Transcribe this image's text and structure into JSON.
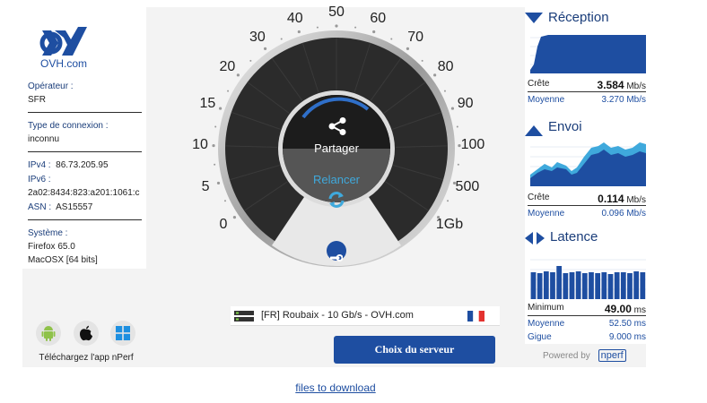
{
  "brand": {
    "name": "OVH.com"
  },
  "info": {
    "operator_label": "Opérateur :",
    "operator_value": "SFR",
    "connection_label": "Type de connexion :",
    "connection_value": "inconnu",
    "ipv4_label": "IPv4 :",
    "ipv4_value": "86.73.205.95",
    "ipv6_label": "IPv6 :",
    "ipv6_value": "2a02:8434:823:a201:1061:c",
    "asn_label": "ASN :",
    "asn_value": "AS15557",
    "system_label": "Système :",
    "system_browser": "Firefox 65.0",
    "system_os": "MacOSX [64 bits]"
  },
  "apps": {
    "download_label": "Téléchargez l'app nPerf"
  },
  "gauge": {
    "ticks": [
      "0",
      "5",
      "10",
      "15",
      "20",
      "30",
      "40",
      "50",
      "60",
      "70",
      "80",
      "90",
      "100",
      "500",
      "1Gb"
    ],
    "share_label": "Partager",
    "restart_label": "Relancer"
  },
  "server": {
    "name": "[FR] Roubaix - 10 Gb/s - OVH.com",
    "choose_label": "Choix du serveur"
  },
  "reception": {
    "title": "Réception",
    "peak_label": "Crête",
    "peak_value": "3.584",
    "peak_unit": "Mb/s",
    "avg_label": "Moyenne",
    "avg_value": "3.270 Mb/s"
  },
  "upload": {
    "title": "Envoi",
    "peak_label": "Crête",
    "peak_value": "0.114",
    "peak_unit": "Mb/s",
    "avg_label": "Moyenne",
    "avg_value": "0.096 Mb/s"
  },
  "latency": {
    "title": "Latence",
    "min_label": "Minimum",
    "min_value": "49.00",
    "min_unit": "ms",
    "avg_label": "Moyenne",
    "avg_value": "52.50 ms",
    "jitter_label": "Gigue",
    "jitter_value": "9.000 ms"
  },
  "footer": {
    "powered_label": "Powered by",
    "nperf_label": "nperf",
    "files_link": "files to download"
  },
  "colors": {
    "accent": "#1e4ea1",
    "chart_fill": "#1e4ea1",
    "chart_light": "#3fa9dc",
    "restart": "#3fa9dc"
  }
}
